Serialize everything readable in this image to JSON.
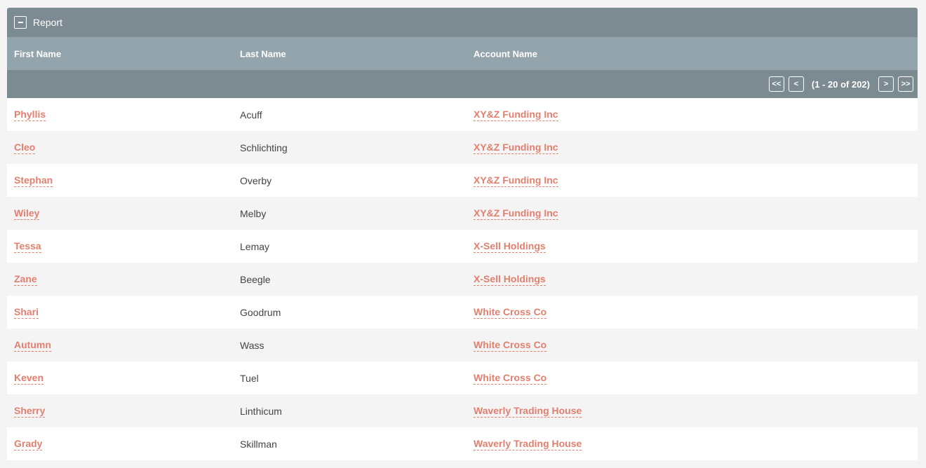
{
  "panel": {
    "title": "Report"
  },
  "columns": {
    "first_name": "First Name",
    "last_name": "Last Name",
    "account_name": "Account Name"
  },
  "pagination": {
    "first": "<<",
    "prev": "<",
    "count": "(1 - 20 of 202)",
    "next": ">",
    "last": ">>"
  },
  "rows": [
    {
      "first": "Phyllis",
      "last": "Acuff",
      "account": "XY&Z Funding Inc"
    },
    {
      "first": "Cleo",
      "last": "Schlichting",
      "account": "XY&Z Funding Inc"
    },
    {
      "first": "Stephan",
      "last": "Overby",
      "account": "XY&Z Funding Inc"
    },
    {
      "first": "Wiley",
      "last": "Melby",
      "account": "XY&Z Funding Inc"
    },
    {
      "first": "Tessa",
      "last": "Lemay",
      "account": "X-Sell Holdings"
    },
    {
      "first": "Zane",
      "last": "Beegle",
      "account": "X-Sell Holdings"
    },
    {
      "first": "Shari",
      "last": "Goodrum",
      "account": "White Cross Co"
    },
    {
      "first": "Autumn",
      "last": "Wass",
      "account": "White Cross Co"
    },
    {
      "first": "Keven",
      "last": "Tuel",
      "account": "White Cross Co"
    },
    {
      "first": "Sherry",
      "last": "Linthicum",
      "account": "Waverly Trading House"
    },
    {
      "first": "Grady",
      "last": "Skillman",
      "account": "Waverly Trading House"
    }
  ]
}
